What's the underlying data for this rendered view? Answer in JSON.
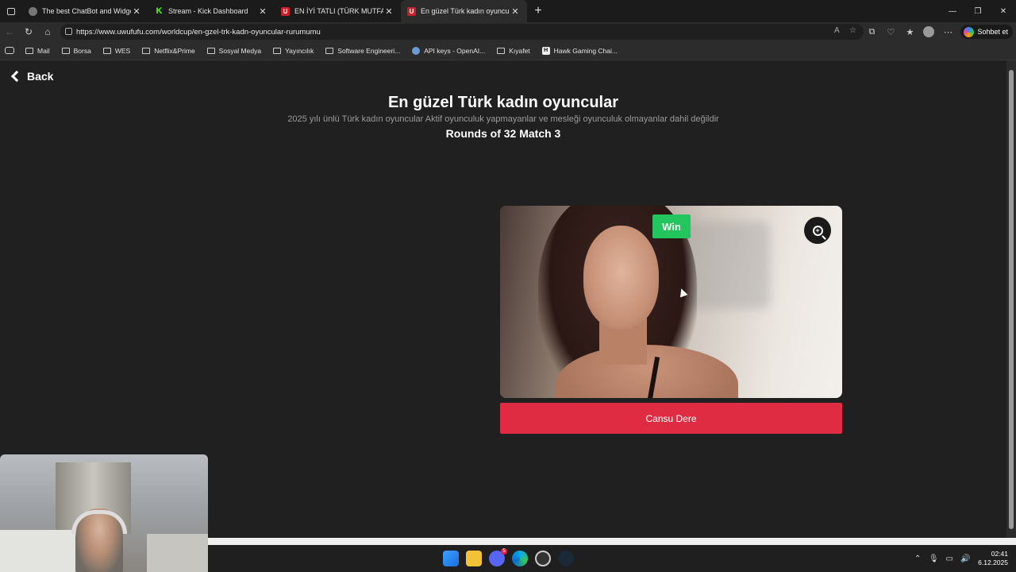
{
  "browser": {
    "tabs": [
      {
        "title": "The best ChatBot and Widgets for",
        "favicon": "globe-icon",
        "active": false
      },
      {
        "title": "Stream - Kick Dashboard",
        "favicon": "kick-icon",
        "active": false
      },
      {
        "title": "EN İYİ TATLI (TÜRK MUTFAĞI) | Uw",
        "favicon": "uwufufu-icon",
        "active": false
      },
      {
        "title": "En güzel Türk kadın oyuncular | Uw",
        "favicon": "uwufufu-icon",
        "active": true
      }
    ],
    "url": "https://www.uwufufu.com/worldcup/en-gzel-trk-kadn-oyuncular-rurumumu",
    "copilot_label": "Sohbet et",
    "bookmarks": [
      {
        "label": "Mail",
        "icon": "folder-icon"
      },
      {
        "label": "Borsa",
        "icon": "folder-icon"
      },
      {
        "label": "WES",
        "icon": "folder-icon"
      },
      {
        "label": "Netflix&Prime",
        "icon": "folder-icon"
      },
      {
        "label": "Sosyal Medya",
        "icon": "folder-icon"
      },
      {
        "label": "Yayıncılık",
        "icon": "folder-icon"
      },
      {
        "label": "Software Engineeri...",
        "icon": "folder-icon"
      },
      {
        "label": "API keys - OpenAI...",
        "icon": "openai-icon"
      },
      {
        "label": "Kıyafet",
        "icon": "folder-icon"
      },
      {
        "label": "Hawk Gaming Chai...",
        "icon": "hawk-icon"
      }
    ]
  },
  "page": {
    "back_label": "Back",
    "title": "En güzel Türk kadın oyuncular",
    "subtitle": "2025 yılı ünlü Türk kadın oyuncular Aktif oyunculuk yapmayanlar ve mesleği oyunculuk olmayanlar dahil değildir",
    "round_info": "Rounds of 32 Match 3",
    "candidate": {
      "name": "Cansu Dere",
      "badge": "Win"
    }
  },
  "taskbar": {
    "apps": [
      "start-icon",
      "file-explorer-icon",
      "discord-icon",
      "edge-icon",
      "chrome-icon",
      "steam-icon"
    ],
    "discord_badge": "5",
    "time": "02:41",
    "date": "6.12.2025"
  },
  "colors": {
    "win_badge": "#22c55e",
    "name_button": "#e02c43",
    "page_bg": "#202020"
  }
}
